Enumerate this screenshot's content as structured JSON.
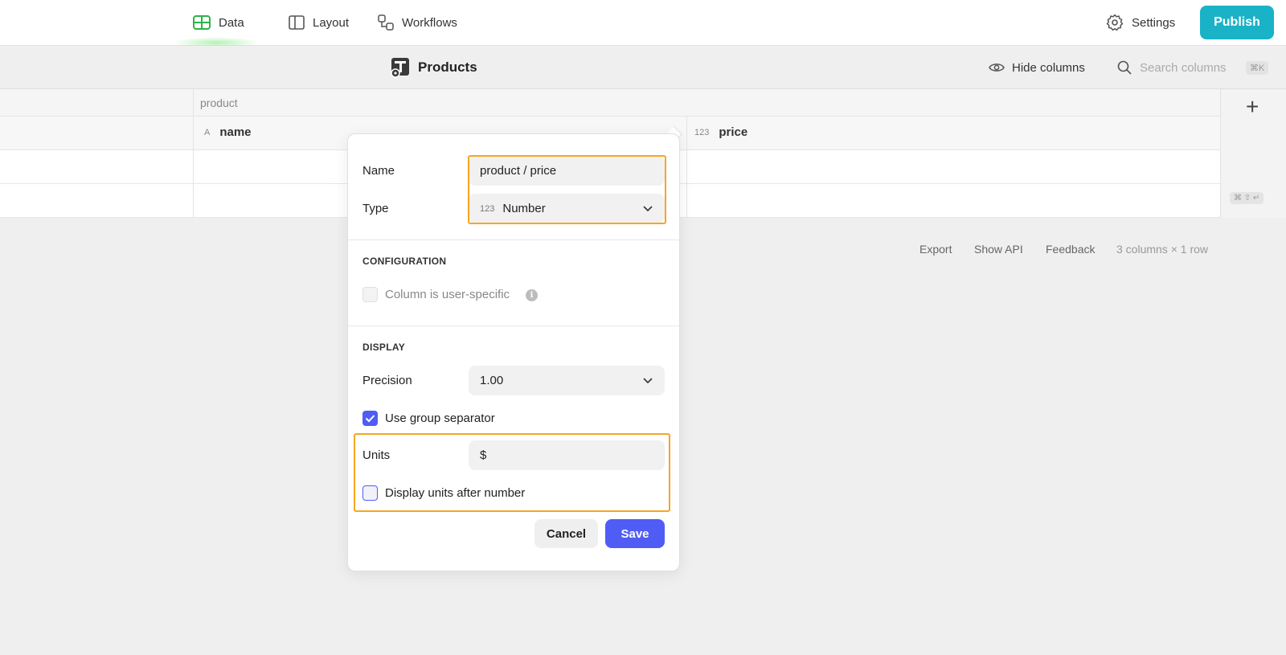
{
  "nav": {
    "tabs": [
      {
        "label": "Data",
        "icon": "table-icon",
        "active": true
      },
      {
        "label": "Layout",
        "icon": "layout-icon"
      },
      {
        "label": "Workflows",
        "icon": "workflows-icon"
      }
    ],
    "settings_label": "Settings",
    "publish_label": "Publish"
  },
  "toolbar": {
    "table_title": "Products",
    "hide_columns_label": "Hide columns",
    "search_placeholder": "Search columns",
    "search_shortcut": "⌘K"
  },
  "grid": {
    "group_label": "product",
    "columns": [
      {
        "icon_text": "A",
        "label": "name"
      },
      {
        "icon_text": "123",
        "label": "price"
      }
    ],
    "add_column_label": "+",
    "add_row_shortcut": "⌘ ⇧ ↵"
  },
  "footer": {
    "export_label": "Export",
    "show_api_label": "Show API",
    "feedback_label": "Feedback",
    "summary": "3 columns × 1 row"
  },
  "popover": {
    "name_label": "Name",
    "name_value": "product / price",
    "type_label": "Type",
    "type_icon_text": "123",
    "type_value": "Number",
    "configuration_title": "CONFIGURATION",
    "user_specific_label": "Column is user-specific",
    "user_specific_checked": false,
    "info_glyph": "i",
    "display_title": "DISPLAY",
    "precision_label": "Precision",
    "precision_value": "1.00",
    "group_separator_label": "Use group separator",
    "group_separator_checked": true,
    "units_label": "Units",
    "units_value": "$",
    "units_after_label": "Display units after number",
    "units_after_checked": false,
    "cancel_label": "Cancel",
    "save_label": "Save"
  },
  "colors": {
    "accent": "#4f5df5",
    "publish": "#19b2c6",
    "highlight": "#f5a623",
    "data_tab_icon": "#2db34a"
  }
}
